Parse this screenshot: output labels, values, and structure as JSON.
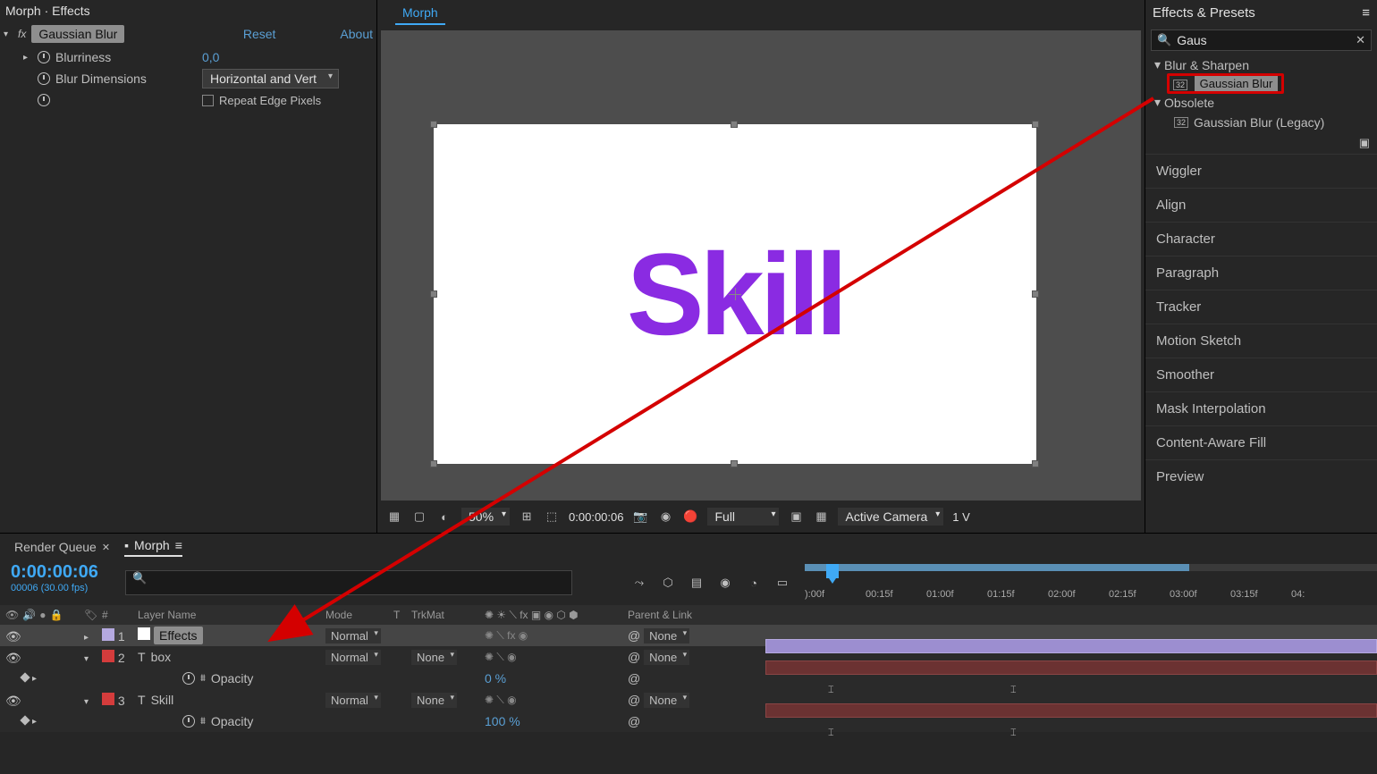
{
  "effectControls": {
    "header": "Morph · Effects",
    "effectName": "Gaussian Blur",
    "reset": "Reset",
    "about": "About",
    "blurriness": {
      "label": "Blurriness",
      "value": "0,0"
    },
    "blurDimensions": {
      "label": "Blur Dimensions",
      "value": "Horizontal and Vert"
    },
    "repeatEdge": "Repeat Edge Pixels"
  },
  "comp": {
    "tab": "Morph",
    "text": "Skill",
    "toolbar": {
      "zoom": "50%",
      "time": "0:00:00:06",
      "res": "Full",
      "view": "Active Camera",
      "views": "1 V"
    }
  },
  "effectsPresets": {
    "title": "Effects & Presets",
    "search": "Gaus",
    "group1": "Blur & Sharpen",
    "item1": "Gaussian Blur",
    "group2": "Obsolete",
    "item2": "Gaussian Blur (Legacy)"
  },
  "sidePanels": [
    "Wiggler",
    "Align",
    "Character",
    "Paragraph",
    "Tracker",
    "Motion Sketch",
    "Smoother",
    "Mask Interpolation",
    "Content-Aware Fill",
    "Preview"
  ],
  "timeline": {
    "tabRender": "Render Queue",
    "tabComp": "Morph",
    "timecode": "0:00:00:06",
    "timecodeSub": "00006 (30.00 fps)",
    "cols": {
      "num": "#",
      "name": "Layer Name",
      "mode": "Mode",
      "t": "T",
      "trk": "TrkMat",
      "parent": "Parent & Link"
    },
    "ticks": [
      "):00f",
      "00:15f",
      "01:00f",
      "01:15f",
      "02:00f",
      "02:15f",
      "03:00f",
      "03:15f",
      "04:"
    ],
    "layers": [
      {
        "num": "1",
        "name": "Effects",
        "mode": "Normal",
        "trk": "",
        "parent": "None",
        "color": "#b5a9e0",
        "sel": true,
        "chip": true,
        "solid": true
      },
      {
        "num": "2",
        "name": "box",
        "type": "T",
        "mode": "Normal",
        "trk": "None",
        "parent": "None",
        "color": "#d43c3c"
      },
      {
        "prop": true,
        "name": "Opacity",
        "value": "0 %"
      },
      {
        "num": "3",
        "name": "Skill",
        "type": "T",
        "mode": "Normal",
        "trk": "None",
        "parent": "None",
        "color": "#d43c3c"
      },
      {
        "prop": true,
        "name": "Opacity",
        "value": "100 %"
      }
    ]
  }
}
